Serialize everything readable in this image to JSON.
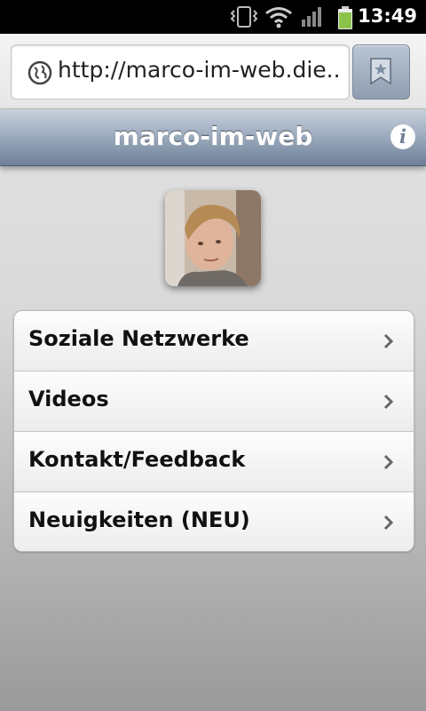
{
  "status_bar": {
    "time": "13:49",
    "icons": [
      "vibrate-icon",
      "wifi-icon",
      "signal-icon",
      "battery-icon"
    ]
  },
  "browser": {
    "url": "http://marco-im-web.die...",
    "url_icon": "globe-icon",
    "bookmark_icon": "bookmark-star-icon"
  },
  "header": {
    "title": "marco-im-web",
    "info_label": "i"
  },
  "profile": {
    "avatar_icon": "profile-photo"
  },
  "menu": {
    "items": [
      {
        "label": "Soziale Netzwerke"
      },
      {
        "label": "Videos"
      },
      {
        "label": "Kontakt/Feedback"
      },
      {
        "label": "Neuigkeiten (NEU)"
      }
    ]
  },
  "colors": {
    "header_gradient_top": "#c8d2de",
    "header_gradient_bottom": "#6e7f97",
    "battery": "#8bc34a"
  }
}
